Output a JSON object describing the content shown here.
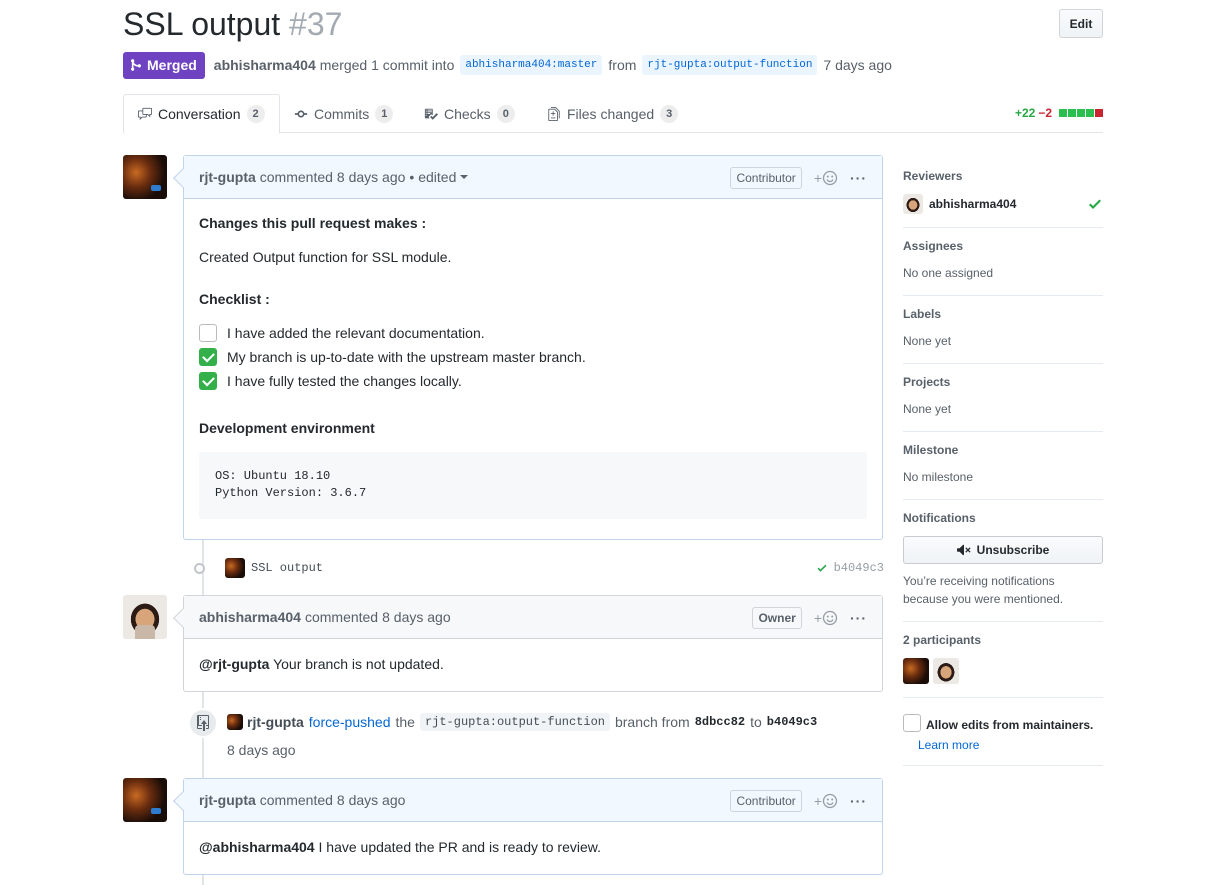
{
  "pr": {
    "title": "SSL output",
    "number": "#37",
    "edit_label": "Edit",
    "state_label": "Merged",
    "author": "abhisharma404",
    "merged_text": "merged 1 commit into",
    "base_ref": "abhisharma404:master",
    "from_text": "from",
    "head_ref": "rjt-gupta:output-function",
    "time": "7 days ago"
  },
  "tabs": [
    {
      "label": "Conversation",
      "count": "2",
      "icon": "comment-discussion-icon"
    },
    {
      "label": "Commits",
      "count": "1",
      "icon": "git-commit-icon"
    },
    {
      "label": "Checks",
      "count": "0",
      "icon": "checklist-icon"
    },
    {
      "label": "Files changed",
      "count": "3",
      "icon": "file-diff-icon"
    }
  ],
  "diffstat": {
    "additions": "+22",
    "deletions": "−2",
    "colors": [
      "#2cbe4e",
      "#2cbe4e",
      "#2cbe4e",
      "#2cbe4e",
      "#cb2431"
    ]
  },
  "comment1": {
    "author": "rjt-gupta",
    "action": "commented",
    "time": "8 days ago",
    "edited": "• edited",
    "role": "Contributor",
    "heading1": "Changes this pull request makes :",
    "para1": "Created Output function for SSL module.",
    "heading2": "Checklist :",
    "checklist": [
      {
        "text": "I have added the relevant documentation.",
        "checked": false
      },
      {
        "text": "My branch is up-to-date with the upstream master branch.",
        "checked": true
      },
      {
        "text": "I have fully tested the changes locally.",
        "checked": true
      }
    ],
    "heading3": "Development environment",
    "code_line1": "OS: Ubuntu 18.10",
    "code_line2": "Python Version: 3.6.7"
  },
  "commit": {
    "message": "SSL output",
    "sha": "b4049c3"
  },
  "comment2": {
    "author": "abhisharma404",
    "action": "commented",
    "time": "8 days ago",
    "role": "Owner",
    "mention": "@rjt-gupta",
    "text": "Your branch is not updated."
  },
  "force_push": {
    "author": "rjt-gupta",
    "action": "force-pushed",
    "the": "the",
    "ref": "rjt-gupta:output-function",
    "branch_from": "branch from",
    "from_sha": "8dbcc82",
    "to": "to",
    "to_sha": "b4049c3",
    "time": "8 days ago"
  },
  "comment3": {
    "author": "rjt-gupta",
    "action": "commented",
    "time": "8 days ago",
    "role": "Contributor",
    "mention": "@abhisharma404",
    "text": "I have updated the PR and is ready to review."
  },
  "sidebar": {
    "reviewers_title": "Reviewers",
    "reviewer": "abhisharma404",
    "assignees_title": "Assignees",
    "assignees_value": "No one assigned",
    "labels_title": "Labels",
    "labels_value": "None yet",
    "projects_title": "Projects",
    "projects_value": "None yet",
    "milestone_title": "Milestone",
    "milestone_value": "No milestone",
    "notifications_title": "Notifications",
    "unsubscribe_label": "Unsubscribe",
    "notif_reason_1": "You’re receiving notifications",
    "notif_reason_2": "because you were mentioned.",
    "participants_title": "2 participants",
    "allow_edits_label": "Allow edits from maintainers.",
    "learn_more": "Learn more"
  },
  "reaction_symbol": "+",
  "more_symbol": "···"
}
